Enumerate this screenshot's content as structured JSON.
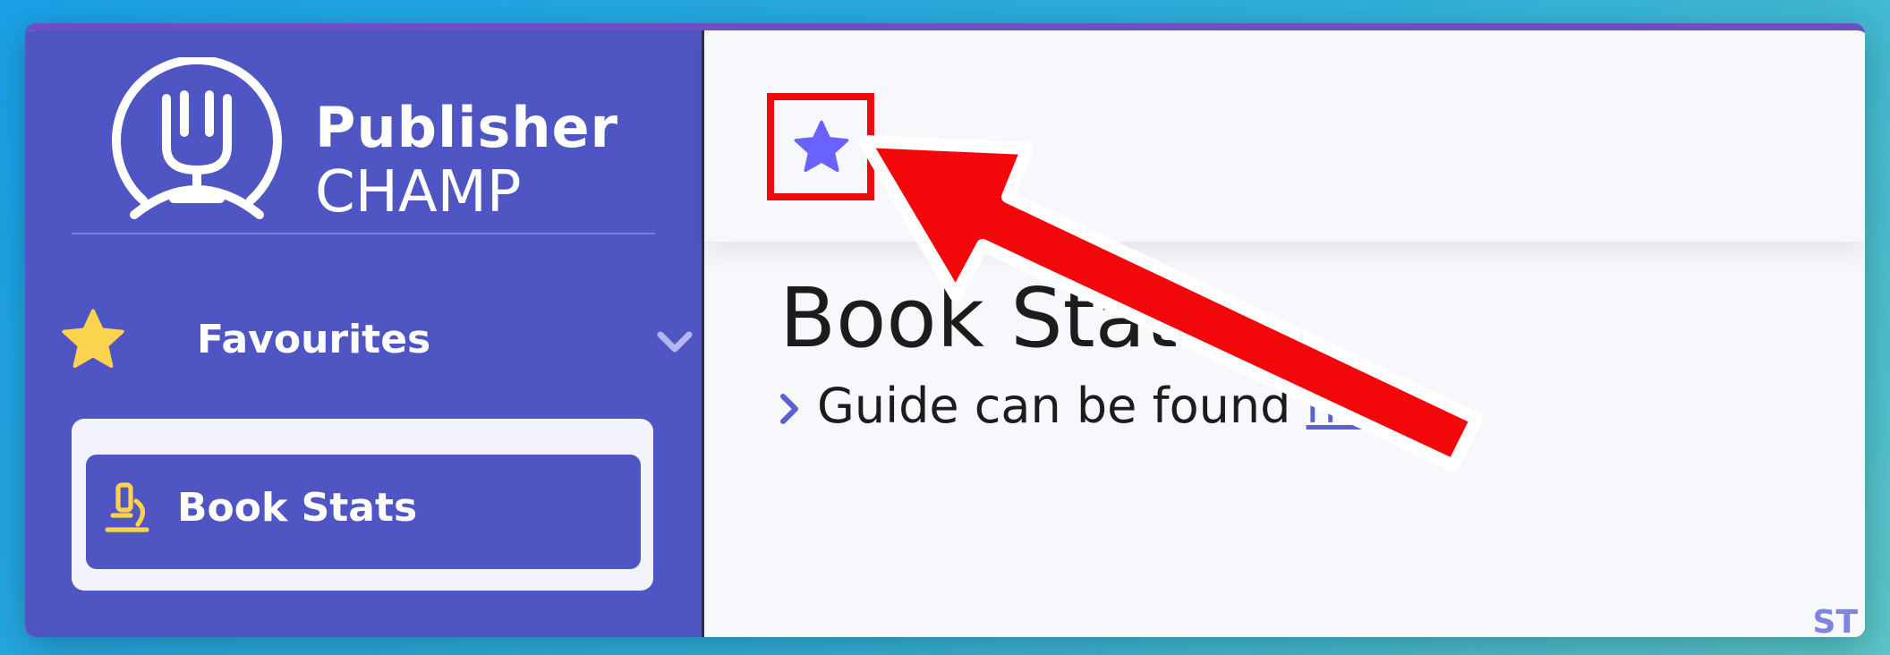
{
  "app": {
    "logo_line1": "Publisher",
    "logo_line2": "CHAMP"
  },
  "sidebar": {
    "favourites_label": "Favourites",
    "items": [
      {
        "label": "Book Stats",
        "icon": "microscope-icon"
      }
    ]
  },
  "main": {
    "title": "Book Stats",
    "guide_text": "Guide can be found",
    "guide_link": "here",
    "corner_text": "ST"
  },
  "colors": {
    "sidebar": "#4f55c2",
    "accent_star": "#6a62ff",
    "fav_star": "#fcd34d",
    "annotation": "#ee0b0b"
  }
}
